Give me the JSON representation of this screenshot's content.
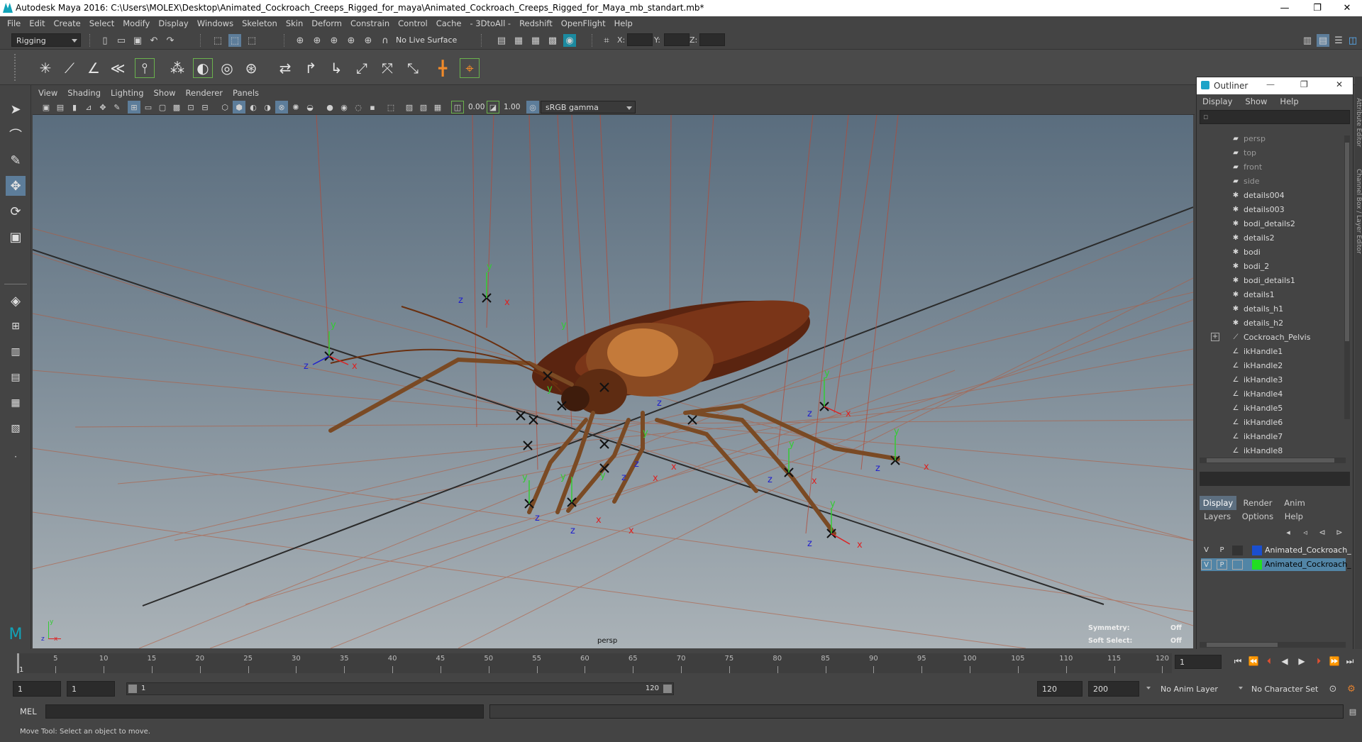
{
  "window": {
    "title": "Autodesk Maya 2016: C:\\Users\\MOLEX\\Desktop\\Animated_Cockroach_Creeps_Rigged_for_maya\\Animated_Cockroach_Creeps_Rigged_for_Maya_mb_standart.mb*",
    "minimize": "—",
    "maximize": "❐",
    "close": "✕"
  },
  "menubar": [
    "File",
    "Edit",
    "Create",
    "Select",
    "Modify",
    "Display",
    "Windows",
    "Skeleton",
    "Skin",
    "Deform",
    "Constrain",
    "Control",
    "Cache",
    "- 3DtoAll -",
    "Redshift",
    "OpenFlight",
    "Help"
  ],
  "statusline": {
    "mode": "Rigging",
    "live_surface": "No Live Surface",
    "x_label": "X:",
    "y_label": "Y:",
    "z_label": "Z:"
  },
  "viewport": {
    "menu": [
      "View",
      "Shading",
      "Lighting",
      "Show",
      "Renderer",
      "Panels"
    ],
    "exposure": "0.00",
    "gamma": "1.00",
    "color_space": "sRGB gamma",
    "camera_label": "persp",
    "symmetry_label": "Symmetry:",
    "symmetry_value": "Off",
    "soft_select_label": "Soft Select:",
    "soft_select_value": "Off",
    "axis_x": "x",
    "axis_y": "y",
    "axis_z": "z"
  },
  "outliner": {
    "title": "Outliner",
    "menu": [
      "Display",
      "Show",
      "Help"
    ],
    "items": [
      {
        "label": "persp",
        "icon": "camera-icon",
        "kind": "camera"
      },
      {
        "label": "top",
        "icon": "camera-icon",
        "kind": "camera"
      },
      {
        "label": "front",
        "icon": "camera-icon",
        "kind": "camera"
      },
      {
        "label": "side",
        "icon": "camera-icon",
        "kind": "camera"
      },
      {
        "label": "details004",
        "icon": "mesh-icon",
        "kind": "mesh"
      },
      {
        "label": "details003",
        "icon": "mesh-icon",
        "kind": "mesh"
      },
      {
        "label": "bodi_details2",
        "icon": "mesh-icon",
        "kind": "mesh"
      },
      {
        "label": "details2",
        "icon": "mesh-icon",
        "kind": "mesh"
      },
      {
        "label": "bodi",
        "icon": "mesh-icon",
        "kind": "mesh"
      },
      {
        "label": "bodi_2",
        "icon": "mesh-icon",
        "kind": "mesh"
      },
      {
        "label": "bodi_details1",
        "icon": "mesh-icon",
        "kind": "mesh"
      },
      {
        "label": "details1",
        "icon": "mesh-icon",
        "kind": "mesh"
      },
      {
        "label": "details_h1",
        "icon": "mesh-icon",
        "kind": "mesh"
      },
      {
        "label": "details_h2",
        "icon": "mesh-icon",
        "kind": "mesh"
      },
      {
        "label": "Cockroach_Pelvis",
        "icon": "joint-icon",
        "kind": "joint"
      },
      {
        "label": "ikHandle1",
        "icon": "ik-handle-icon",
        "kind": "ik"
      },
      {
        "label": "ikHandle2",
        "icon": "ik-handle-icon",
        "kind": "ik"
      },
      {
        "label": "ikHandle3",
        "icon": "ik-handle-icon",
        "kind": "ik"
      },
      {
        "label": "ikHandle4",
        "icon": "ik-handle-icon",
        "kind": "ik"
      },
      {
        "label": "ikHandle5",
        "icon": "ik-handle-icon",
        "kind": "ik"
      },
      {
        "label": "ikHandle6",
        "icon": "ik-handle-icon",
        "kind": "ik"
      },
      {
        "label": "ikHandle7",
        "icon": "ik-handle-icon",
        "kind": "ik"
      },
      {
        "label": "ikHandle8",
        "icon": "ik-handle-icon",
        "kind": "ik"
      }
    ],
    "expand_symbol": "+"
  },
  "layer_editor": {
    "tabs": [
      "Display",
      "Render",
      "Anim"
    ],
    "menu": [
      "Layers",
      "Options",
      "Help"
    ],
    "layers": [
      {
        "v": "V",
        "p": "P",
        "name": "Animated_Cockroach_",
        "color": "#1a4fd0",
        "selected": false
      },
      {
        "v": "V",
        "p": "P",
        "name": "Animated_Cockroach_",
        "color": "#22dd22",
        "selected": true
      }
    ]
  },
  "side_tabs": {
    "attribute_editor": "Attribute Editor",
    "channel_box": "Channel Box / Layer Editor"
  },
  "timeline": {
    "ticks": [
      5,
      10,
      15,
      20,
      25,
      30,
      35,
      40,
      45,
      50,
      55,
      60,
      65,
      70,
      75,
      80,
      85,
      90,
      95,
      100,
      105,
      110,
      115,
      120
    ],
    "start_label": "1",
    "current_frame": "1"
  },
  "range": {
    "start": "1",
    "playback_start": "1",
    "range_start_label": "1",
    "range_end_label": "120",
    "playback_end": "120",
    "end": "200",
    "anim_layer": "No Anim Layer",
    "character_set": "No Character Set"
  },
  "command_line": {
    "label": "MEL"
  },
  "help_line": {
    "text": "Move Tool: Select an object to move."
  },
  "colors": {
    "accent": "#1aa3c8",
    "joint_x": "#dd2222",
    "joint_y": "#33cc33",
    "joint_z": "#2222cc"
  }
}
